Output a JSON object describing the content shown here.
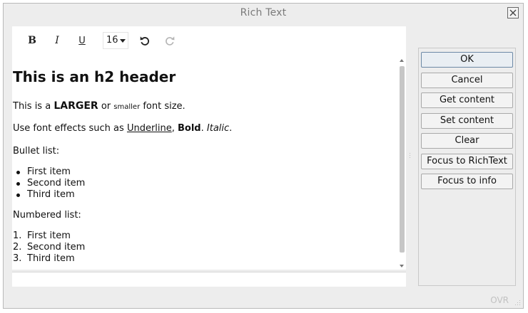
{
  "window": {
    "title": "Rich Text"
  },
  "toolbar": {
    "bold_label": "B",
    "italic_label": "I",
    "underline_label": "U",
    "font_size": "16"
  },
  "content": {
    "heading": "This is an h2 header",
    "line1": {
      "a": "This is a ",
      "larger": "LARGER",
      "b": " or ",
      "smaller": "smaller",
      "c": " font size."
    },
    "line2": {
      "a": "Use font effects such as ",
      "underline": "Underline",
      "b": ", ",
      "bold": "Bold",
      "c": ". ",
      "italic": "Italic",
      "d": "."
    },
    "bullet_label": "Bullet list:",
    "bullet_items": [
      "First item",
      "Second item",
      "Third item"
    ],
    "numbered_label": "Numbered list:",
    "numbered_markers": [
      "1.",
      "2.",
      "3."
    ],
    "numbered_items": [
      "First item",
      "Second item",
      "Third item"
    ]
  },
  "buttons": {
    "ok": "OK",
    "cancel": "Cancel",
    "get_content": "Get content",
    "set_content": "Set content",
    "clear": "Clear",
    "focus_richtext": "Focus to RichText",
    "focus_info": "Focus to info"
  },
  "status": {
    "mode": "OVR"
  },
  "icons": {
    "close": "close-icon",
    "undo": "undo-icon",
    "redo": "redo-icon",
    "dropdown": "chevron-down-icon"
  }
}
